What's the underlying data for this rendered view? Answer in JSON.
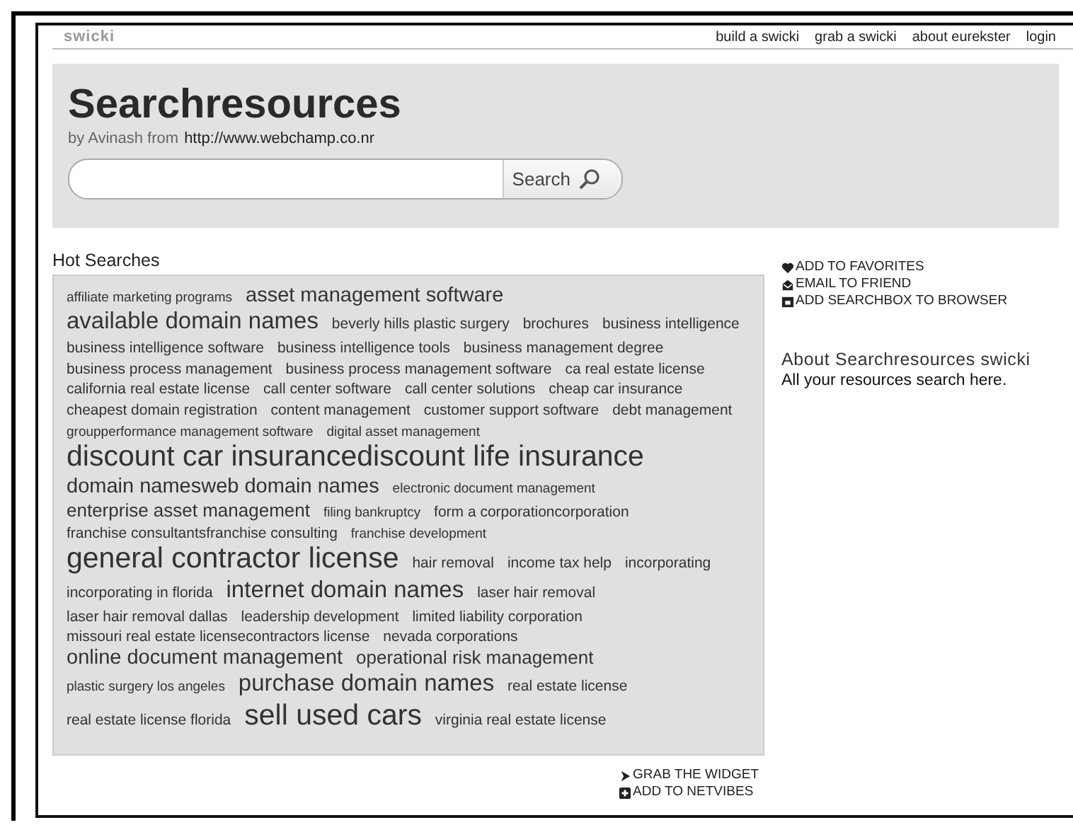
{
  "topbar": {
    "logo": "swicki",
    "links": [
      "build a swicki",
      "grab a swicki",
      "about eurekster",
      "login"
    ]
  },
  "header": {
    "title": "Searchresources",
    "byline": "by Avinash from",
    "url": "http://www.webchamp.co.nr",
    "search_button": "Search"
  },
  "hot_searches": {
    "title": "Hot Searches",
    "tags": [
      {
        "text": "affiliate marketing programs",
        "kind": "xs"
      },
      {
        "text": "asset management software",
        "kind": "l"
      },
      {
        "text": "available domain names",
        "kind": "xl"
      },
      {
        "text": "beverly hills plastic surgery",
        "kind": "s"
      },
      {
        "text": "brochures",
        "kind": "s"
      },
      {
        "text": "business intelligence",
        "kind": "s"
      },
      {
        "text": "business intelligence software",
        "kind": "s"
      },
      {
        "text": "business intelligence tools",
        "kind": "s"
      },
      {
        "text": "business management degree",
        "kind": "s"
      },
      {
        "text": "business process management",
        "kind": "s"
      },
      {
        "text": "business process management software",
        "kind": "s"
      },
      {
        "text": "ca real estate license",
        "kind": "s"
      },
      {
        "text": "california real estate license",
        "kind": "s"
      },
      {
        "text": "call center software",
        "kind": "s"
      },
      {
        "text": "call center solutions",
        "kind": "s"
      },
      {
        "text": "cheap car insurance",
        "kind": "s"
      },
      {
        "text": "cheapest domain registration",
        "kind": "s"
      },
      {
        "text": "content management",
        "kind": "s"
      },
      {
        "text": "customer support software",
        "kind": "s"
      },
      {
        "text": "debt management",
        "kind": "s"
      },
      {
        "text": "groupperformance management software",
        "kind": "xs"
      },
      {
        "text": "digital asset management",
        "kind": "xs"
      },
      {
        "text": "discount car insurancediscount life insurance",
        "kind": "xxl"
      },
      {
        "text": "domain namesweb domain names",
        "kind": "l"
      },
      {
        "text": "electronic document management",
        "kind": "xs"
      },
      {
        "text": "enterprise asset management",
        "kind": "m"
      },
      {
        "text": "filing bankruptcy",
        "kind": "xs"
      },
      {
        "text": "form a corporationcorporation",
        "kind": "s"
      },
      {
        "text": "franchise consultantsfranchise consulting",
        "kind": "s"
      },
      {
        "text": "franchise development",
        "kind": "xs"
      },
      {
        "text": "general contractor license",
        "kind": "xxl"
      },
      {
        "text": "hair removal",
        "kind": "s"
      },
      {
        "text": "income tax help",
        "kind": "s"
      },
      {
        "text": "incorporating",
        "kind": "s"
      },
      {
        "text": "incorporating in florida",
        "kind": "s"
      },
      {
        "text": "internet domain names",
        "kind": "xl"
      },
      {
        "text": "laser hair removal",
        "kind": "s"
      },
      {
        "text": "laser hair removal dallas",
        "kind": "s"
      },
      {
        "text": "leadership development",
        "kind": "s"
      },
      {
        "text": "limited liability corporation",
        "kind": "s"
      },
      {
        "text": "missouri real estate licensecontractors license",
        "kind": "s"
      },
      {
        "text": "nevada corporations",
        "kind": "s"
      },
      {
        "text": "online document management",
        "kind": "l"
      },
      {
        "text": "operational risk management",
        "kind": "m"
      },
      {
        "text": "plastic surgery los angeles",
        "kind": "xs"
      },
      {
        "text": "purchase domain names",
        "kind": "xl"
      },
      {
        "text": "real estate license",
        "kind": "s"
      },
      {
        "text": "real estate license florida",
        "kind": "s"
      },
      {
        "text": "sell used cars",
        "kind": "xxl"
      },
      {
        "text": "virginia real estate license",
        "kind": "s"
      }
    ]
  },
  "actions": [
    {
      "label": "ADD TO FAVORITES",
      "kind": "heart"
    },
    {
      "label": "EMAIL TO FRIEND",
      "kind": "mail"
    },
    {
      "label": "ADD SEARCHBOX TO BROWSER",
      "kind": "box"
    }
  ],
  "about": {
    "title": "About Searchresources swicki",
    "text": "All your resources search here."
  },
  "widget_links": [
    {
      "label": "GRAB THE WIDGET",
      "kind": "arrow"
    },
    {
      "label": "ADD TO NETVIBES",
      "kind": "plus"
    }
  ]
}
